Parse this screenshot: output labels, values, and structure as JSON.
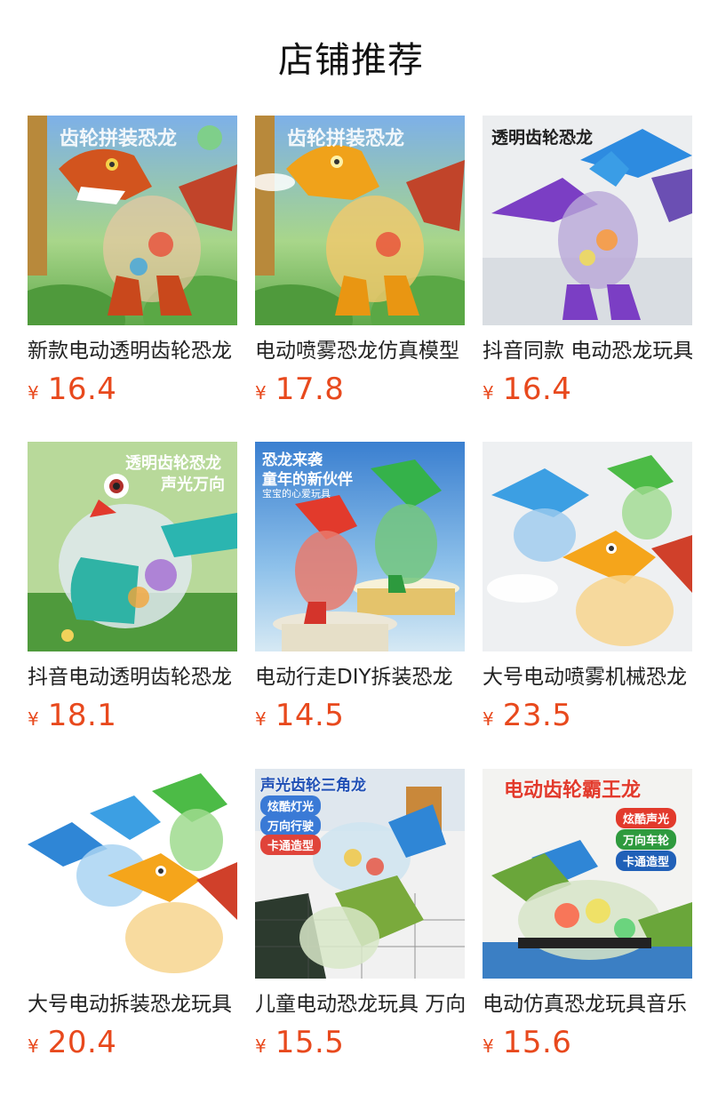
{
  "page": {
    "title": "店铺推荐"
  },
  "currency_symbol": "¥",
  "products": [
    {
      "name": "新款电动透明齿轮恐龙",
      "price": "16.4",
      "image_text": "齿轮拼装恐龙"
    },
    {
      "name": "电动喷雾恐龙仿真模型",
      "price": "17.8",
      "image_text": "齿轮拼装恐龙"
    },
    {
      "name": "抖音同款 电动恐龙玩具",
      "price": "16.4",
      "image_text": "透明齿轮恐龙"
    },
    {
      "name": "抖音电动透明齿轮恐龙",
      "price": "18.1",
      "image_text": "透明齿轮恐龙",
      "image_text2": "声光万向"
    },
    {
      "name": "电动行走DIY拆装恐龙",
      "price": "14.5",
      "image_text": "恐龙来袭",
      "image_text2": "童年的新伙伴",
      "image_text3": "宝宝的心爱玩具"
    },
    {
      "name": "大号电动喷雾机械恐龙",
      "price": "23.5"
    },
    {
      "name": "大号电动拆装恐龙玩具",
      "price": "20.4"
    },
    {
      "name": "儿童电动恐龙玩具 万向",
      "price": "15.5",
      "image_text": "声光齿轮三角龙",
      "badges": [
        "炫酷灯光",
        "万向行驶",
        "卡通造型"
      ]
    },
    {
      "name": "电动仿真恐龙玩具音乐",
      "price": "15.6",
      "image_text": "电动齿轮霸王龙",
      "badges": [
        "炫酷声光",
        "万向车轮",
        "卡通造型"
      ]
    }
  ],
  "colors": {
    "price": "#e8491d",
    "title": "#111111"
  }
}
